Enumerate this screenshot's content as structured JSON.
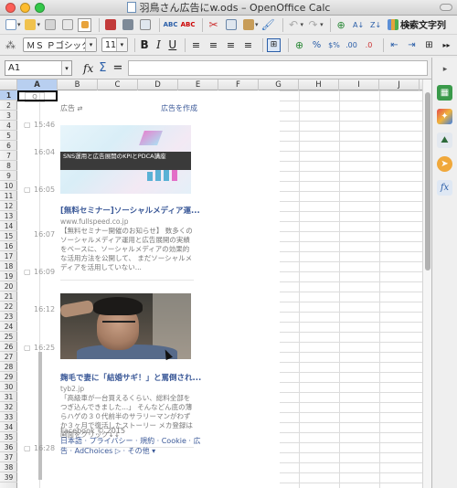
{
  "window": {
    "title": "羽鳥さん広告にw.ods – OpenOffice Calc"
  },
  "toolbar": {
    "find_label": "検索文字列"
  },
  "formatting": {
    "font_name": "ＭＳ Ｐゴシック",
    "font_size": "11",
    "bold": "B",
    "italic": "I",
    "underline": "U"
  },
  "formula_bar": {
    "cell_ref": "A1",
    "fx": "fx",
    "sigma": "Σ",
    "equals": "=",
    "formula": ""
  },
  "grid": {
    "columns": [
      "A",
      "B",
      "C",
      "D",
      "E",
      "F",
      "G",
      "H",
      "I",
      "J"
    ],
    "rows": [
      "1",
      "2",
      "3",
      "4",
      "5",
      "6",
      "7",
      "8",
      "9",
      "10",
      "11",
      "12",
      "13",
      "14",
      "15",
      "16",
      "17",
      "18",
      "19",
      "20",
      "21",
      "22",
      "23",
      "24",
      "25",
      "26",
      "27",
      "28",
      "29",
      "30",
      "31",
      "32",
      "33",
      "34",
      "35",
      "36",
      "37",
      "38",
      "39"
    ],
    "selected_cell": "A1"
  },
  "pasted_image": {
    "timeline_times": [
      "15:46",
      "16:04",
      "16:05",
      "16:07",
      "16:09",
      "16:12",
      "16:25",
      "16:28"
    ],
    "ad_header": "広告",
    "ad_create": "広告を作成",
    "ad1": {
      "banner_text": "SNS運用と広告展開のKPIとPDCA講座",
      "title": "[無料セミナー]ソーシャルメディア運...",
      "url": "www.fullspeed.co.jp",
      "body": "【無料セミナー開催のお知らせ】 数多くのソーシャルメディア運用と広告展開の実績をベースに、ソーシャルメディアの効果的な活用方法を公開して、 まだソーシャルメディアを活用していない..."
    },
    "ad2": {
      "title": "麹毛で妻に「結婚サギ！」と罵倒され...",
      "url": "tyb2.jp",
      "body": "「高級車が一台買えるくらい、総料全部を つぎ込んできました...」 そんなどん底の薄らハゲの３０代前半のサラリーマンがわずか３ヶ月で復活したストーリー メカ登録は画面をクリック↓↓"
    },
    "footer_copy": "Facebook © 2015",
    "footer_links": "日本語 · プライバシー · 規約 · Cookie · 広告 · AdChoices ▷ · その他 ▾"
  }
}
